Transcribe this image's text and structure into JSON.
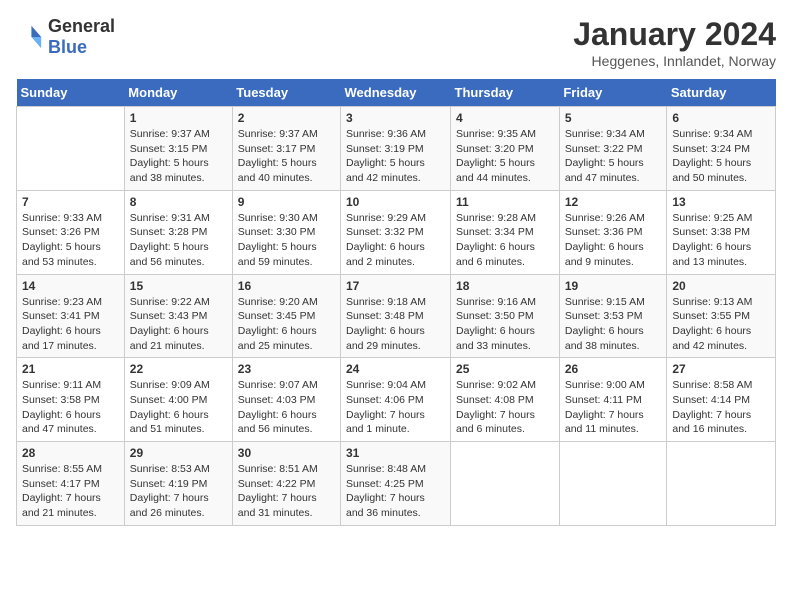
{
  "header": {
    "logo_general": "General",
    "logo_blue": "Blue",
    "month_title": "January 2024",
    "subtitle": "Heggenes, Innlandet, Norway"
  },
  "weekdays": [
    "Sunday",
    "Monday",
    "Tuesday",
    "Wednesday",
    "Thursday",
    "Friday",
    "Saturday"
  ],
  "weeks": [
    [
      {
        "day": "",
        "sunrise": "",
        "sunset": "",
        "daylight": ""
      },
      {
        "day": "1",
        "sunrise": "Sunrise: 9:37 AM",
        "sunset": "Sunset: 3:15 PM",
        "daylight": "Daylight: 5 hours and 38 minutes."
      },
      {
        "day": "2",
        "sunrise": "Sunrise: 9:37 AM",
        "sunset": "Sunset: 3:17 PM",
        "daylight": "Daylight: 5 hours and 40 minutes."
      },
      {
        "day": "3",
        "sunrise": "Sunrise: 9:36 AM",
        "sunset": "Sunset: 3:19 PM",
        "daylight": "Daylight: 5 hours and 42 minutes."
      },
      {
        "day": "4",
        "sunrise": "Sunrise: 9:35 AM",
        "sunset": "Sunset: 3:20 PM",
        "daylight": "Daylight: 5 hours and 44 minutes."
      },
      {
        "day": "5",
        "sunrise": "Sunrise: 9:34 AM",
        "sunset": "Sunset: 3:22 PM",
        "daylight": "Daylight: 5 hours and 47 minutes."
      },
      {
        "day": "6",
        "sunrise": "Sunrise: 9:34 AM",
        "sunset": "Sunset: 3:24 PM",
        "daylight": "Daylight: 5 hours and 50 minutes."
      }
    ],
    [
      {
        "day": "7",
        "sunrise": "Sunrise: 9:33 AM",
        "sunset": "Sunset: 3:26 PM",
        "daylight": "Daylight: 5 hours and 53 minutes."
      },
      {
        "day": "8",
        "sunrise": "Sunrise: 9:31 AM",
        "sunset": "Sunset: 3:28 PM",
        "daylight": "Daylight: 5 hours and 56 minutes."
      },
      {
        "day": "9",
        "sunrise": "Sunrise: 9:30 AM",
        "sunset": "Sunset: 3:30 PM",
        "daylight": "Daylight: 5 hours and 59 minutes."
      },
      {
        "day": "10",
        "sunrise": "Sunrise: 9:29 AM",
        "sunset": "Sunset: 3:32 PM",
        "daylight": "Daylight: 6 hours and 2 minutes."
      },
      {
        "day": "11",
        "sunrise": "Sunrise: 9:28 AM",
        "sunset": "Sunset: 3:34 PM",
        "daylight": "Daylight: 6 hours and 6 minutes."
      },
      {
        "day": "12",
        "sunrise": "Sunrise: 9:26 AM",
        "sunset": "Sunset: 3:36 PM",
        "daylight": "Daylight: 6 hours and 9 minutes."
      },
      {
        "day": "13",
        "sunrise": "Sunrise: 9:25 AM",
        "sunset": "Sunset: 3:38 PM",
        "daylight": "Daylight: 6 hours and 13 minutes."
      }
    ],
    [
      {
        "day": "14",
        "sunrise": "Sunrise: 9:23 AM",
        "sunset": "Sunset: 3:41 PM",
        "daylight": "Daylight: 6 hours and 17 minutes."
      },
      {
        "day": "15",
        "sunrise": "Sunrise: 9:22 AM",
        "sunset": "Sunset: 3:43 PM",
        "daylight": "Daylight: 6 hours and 21 minutes."
      },
      {
        "day": "16",
        "sunrise": "Sunrise: 9:20 AM",
        "sunset": "Sunset: 3:45 PM",
        "daylight": "Daylight: 6 hours and 25 minutes."
      },
      {
        "day": "17",
        "sunrise": "Sunrise: 9:18 AM",
        "sunset": "Sunset: 3:48 PM",
        "daylight": "Daylight: 6 hours and 29 minutes."
      },
      {
        "day": "18",
        "sunrise": "Sunrise: 9:16 AM",
        "sunset": "Sunset: 3:50 PM",
        "daylight": "Daylight: 6 hours and 33 minutes."
      },
      {
        "day": "19",
        "sunrise": "Sunrise: 9:15 AM",
        "sunset": "Sunset: 3:53 PM",
        "daylight": "Daylight: 6 hours and 38 minutes."
      },
      {
        "day": "20",
        "sunrise": "Sunrise: 9:13 AM",
        "sunset": "Sunset: 3:55 PM",
        "daylight": "Daylight: 6 hours and 42 minutes."
      }
    ],
    [
      {
        "day": "21",
        "sunrise": "Sunrise: 9:11 AM",
        "sunset": "Sunset: 3:58 PM",
        "daylight": "Daylight: 6 hours and 47 minutes."
      },
      {
        "day": "22",
        "sunrise": "Sunrise: 9:09 AM",
        "sunset": "Sunset: 4:00 PM",
        "daylight": "Daylight: 6 hours and 51 minutes."
      },
      {
        "day": "23",
        "sunrise": "Sunrise: 9:07 AM",
        "sunset": "Sunset: 4:03 PM",
        "daylight": "Daylight: 6 hours and 56 minutes."
      },
      {
        "day": "24",
        "sunrise": "Sunrise: 9:04 AM",
        "sunset": "Sunset: 4:06 PM",
        "daylight": "Daylight: 7 hours and 1 minute."
      },
      {
        "day": "25",
        "sunrise": "Sunrise: 9:02 AM",
        "sunset": "Sunset: 4:08 PM",
        "daylight": "Daylight: 7 hours and 6 minutes."
      },
      {
        "day": "26",
        "sunrise": "Sunrise: 9:00 AM",
        "sunset": "Sunset: 4:11 PM",
        "daylight": "Daylight: 7 hours and 11 minutes."
      },
      {
        "day": "27",
        "sunrise": "Sunrise: 8:58 AM",
        "sunset": "Sunset: 4:14 PM",
        "daylight": "Daylight: 7 hours and 16 minutes."
      }
    ],
    [
      {
        "day": "28",
        "sunrise": "Sunrise: 8:55 AM",
        "sunset": "Sunset: 4:17 PM",
        "daylight": "Daylight: 7 hours and 21 minutes."
      },
      {
        "day": "29",
        "sunrise": "Sunrise: 8:53 AM",
        "sunset": "Sunset: 4:19 PM",
        "daylight": "Daylight: 7 hours and 26 minutes."
      },
      {
        "day": "30",
        "sunrise": "Sunrise: 8:51 AM",
        "sunset": "Sunset: 4:22 PM",
        "daylight": "Daylight: 7 hours and 31 minutes."
      },
      {
        "day": "31",
        "sunrise": "Sunrise: 8:48 AM",
        "sunset": "Sunset: 4:25 PM",
        "daylight": "Daylight: 7 hours and 36 minutes."
      },
      {
        "day": "",
        "sunrise": "",
        "sunset": "",
        "daylight": ""
      },
      {
        "day": "",
        "sunrise": "",
        "sunset": "",
        "daylight": ""
      },
      {
        "day": "",
        "sunrise": "",
        "sunset": "",
        "daylight": ""
      }
    ]
  ]
}
